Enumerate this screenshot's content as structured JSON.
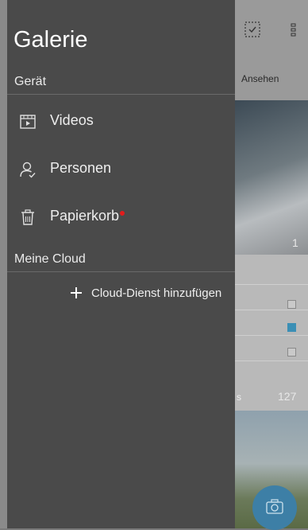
{
  "drawer": {
    "title": "Galerie",
    "device_section": "Gerät",
    "items": [
      {
        "label": "Videos",
        "icon": "video-icon"
      },
      {
        "label": "Personen",
        "icon": "person-icon"
      },
      {
        "label": "Papierkorb",
        "icon": "trash-icon",
        "badge": "red-dot"
      }
    ],
    "cloud_section": "Meine Cloud",
    "add_cloud_label": "Cloud-Dienst hinzufügen"
  },
  "background": {
    "tab_label": "Ansehen",
    "photo_count": "1",
    "album_count": "127",
    "album_label_fragment": "s"
  },
  "colors": {
    "drawer_bg": "#4a4a4a",
    "accent_red": "#e31b1b",
    "fab_blue": "#3d7fa6"
  }
}
